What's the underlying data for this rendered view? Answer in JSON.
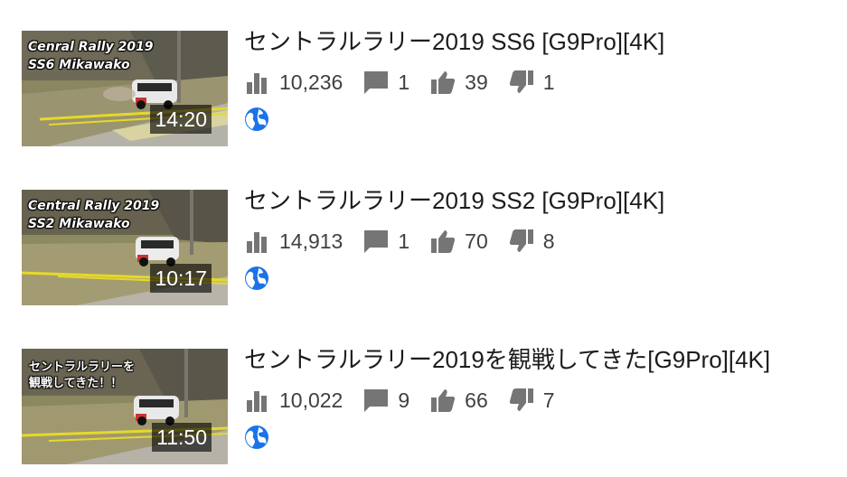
{
  "videos": [
    {
      "thumbnail_caption": "Cenral Rally 2019\nSS6 Mikawako",
      "duration": "14:20",
      "title": "セントラルラリー2019 SS6 [G9Pro][4K]",
      "views": "10,236",
      "comments": "1",
      "likes": "39",
      "dislikes": "1",
      "visibility_icon": "globe-icon"
    },
    {
      "thumbnail_caption": "Central Rally 2019\nSS2 Mikawako",
      "duration": "10:17",
      "title": "セントラルラリー2019 SS2 [G9Pro][4K]",
      "views": "14,913",
      "comments": "1",
      "likes": "70",
      "dislikes": "8",
      "visibility_icon": "globe-icon"
    },
    {
      "thumbnail_caption": "セントラルラリーを\n観戦してきた！！",
      "duration": "11:50",
      "title": "セントラルラリー2019を観戦してきた[G9Pro][4K]",
      "views": "10,022",
      "comments": "9",
      "likes": "66",
      "dislikes": "7",
      "visibility_icon": "globe-icon"
    }
  ],
  "icons": {
    "views": "bar-chart-icon",
    "comments": "comment-icon",
    "likes": "thumbs-up-icon",
    "dislikes": "thumbs-down-icon"
  },
  "colors": {
    "icon_gray": "#757575",
    "globe_blue": "#1a73e8",
    "text": "#1c1c1c"
  }
}
